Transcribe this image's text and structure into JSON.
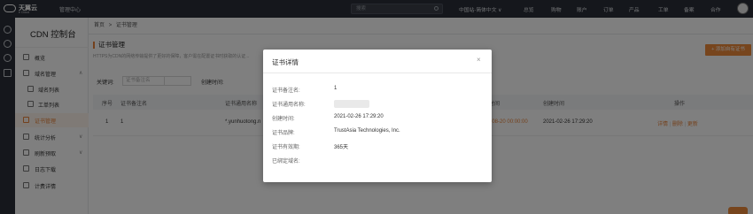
{
  "topbar": {
    "logo_name": "天翼云",
    "logo_sub": "e Cloud",
    "mgmt": "管理中心",
    "search_placeholder": "搜索",
    "nav": [
      "中国站-简体中文 ∨",
      "总览",
      "购物",
      "账户",
      "订单",
      "产品",
      "工单",
      "备案",
      "合作"
    ]
  },
  "sidebar": {
    "title": "CDN 控制台",
    "items": [
      {
        "label": "概览"
      },
      {
        "label": "域名管理",
        "chevron": "∧"
      },
      {
        "label": "域名列表"
      },
      {
        "label": "工单列表"
      },
      {
        "label": "证书管理"
      },
      {
        "label": "统计分析",
        "chevron": "∨"
      },
      {
        "label": "刷新预取",
        "chevron": "∨"
      },
      {
        "label": "日志下载"
      },
      {
        "label": "计费详情"
      }
    ]
  },
  "breadcrumb": {
    "home": "首页",
    "sep": ">",
    "current": "证书管理"
  },
  "page": {
    "title": "证书管理",
    "desc": "HTTPS为CDN的网络传输提供了更好的保障，客户需在配置证书时获取的认证...",
    "add_button": "+ 添加自有证书",
    "keyword_label": "关键词:",
    "keyword_select": "证书备注名",
    "created_label": "创建时间:"
  },
  "table": {
    "headers": [
      "序号",
      "证书备注名",
      "证书通用名称",
      "到期时间",
      "创建时间",
      "操作"
    ],
    "row": {
      "index": "1",
      "name": "1",
      "common_name": "*.yunhuotong.n",
      "expire": "2023-08-20 00:00:00",
      "created": "2021-02-26 17:29:20",
      "actions": [
        "详情",
        "删除",
        "更新"
      ],
      "action_sep": "|"
    }
  },
  "modal": {
    "title": "证书详情",
    "close": "×",
    "fields": [
      {
        "key": "证书备注名:",
        "value": "1"
      },
      {
        "key": "证书通用名称:",
        "value": ""
      },
      {
        "key": "创建时间:",
        "value": "2021-02-26 17:29:20"
      },
      {
        "key": "证书品牌:",
        "value": "TrustAsia Technologies, Inc."
      },
      {
        "key": "证书有效期:",
        "value": "365天"
      },
      {
        "key": "已绑定域名:",
        "value": ""
      }
    ]
  },
  "colors": {
    "accent": "#e8833a",
    "topbar": "#2b2f38"
  }
}
